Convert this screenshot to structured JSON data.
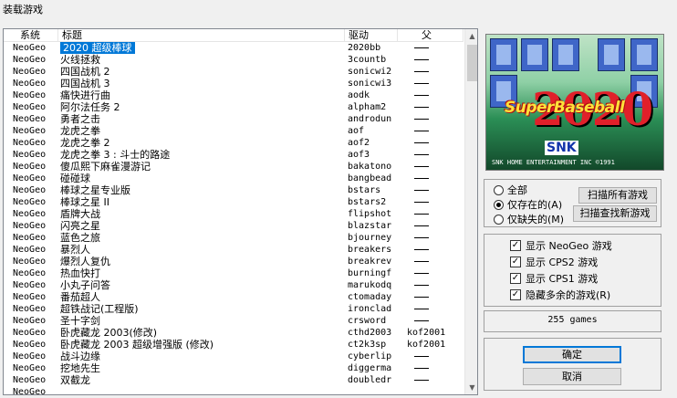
{
  "window": {
    "title": "装载游戏"
  },
  "list": {
    "headers": {
      "system": "系统",
      "title": "标题",
      "driver": "驱动",
      "parent": "父"
    },
    "rows": [
      {
        "system": "NeoGeo",
        "title": "2020 超级棒球",
        "driver": "2020bb",
        "parent": "",
        "selected": true
      },
      {
        "system": "NeoGeo",
        "title": "火线拯救",
        "driver": "3countb",
        "parent": ""
      },
      {
        "system": "NeoGeo",
        "title": "四国战机 2",
        "driver": "sonicwi2",
        "parent": ""
      },
      {
        "system": "NeoGeo",
        "title": "四国战机 3",
        "driver": "sonicwi3",
        "parent": ""
      },
      {
        "system": "NeoGeo",
        "title": "痛快进行曲",
        "driver": "aodk",
        "parent": ""
      },
      {
        "system": "NeoGeo",
        "title": "阿尔法任务 2",
        "driver": "alpham2",
        "parent": ""
      },
      {
        "system": "NeoGeo",
        "title": "勇者之击",
        "driver": "androdun",
        "parent": ""
      },
      {
        "system": "NeoGeo",
        "title": "龙虎之拳",
        "driver": "aof",
        "parent": ""
      },
      {
        "system": "NeoGeo",
        "title": "龙虎之拳 2",
        "driver": "aof2",
        "parent": ""
      },
      {
        "system": "NeoGeo",
        "title": "龙虎之拳 3 : 斗士的路途",
        "driver": "aof3",
        "parent": ""
      },
      {
        "system": "NeoGeo",
        "title": "傻瓜熙下麻雀漫游记",
        "driver": "bakatono",
        "parent": ""
      },
      {
        "system": "NeoGeo",
        "title": "碰碰球",
        "driver": "bangbead",
        "parent": ""
      },
      {
        "system": "NeoGeo",
        "title": "棒球之星专业版",
        "driver": "bstars",
        "parent": ""
      },
      {
        "system": "NeoGeo",
        "title": "棒球之星 II",
        "driver": "bstars2",
        "parent": ""
      },
      {
        "system": "NeoGeo",
        "title": "盾牌大战",
        "driver": "flipshot",
        "parent": ""
      },
      {
        "system": "NeoGeo",
        "title": "闪亮之星",
        "driver": "blazstar",
        "parent": ""
      },
      {
        "system": "NeoGeo",
        "title": "蓝色之旅",
        "driver": "bjourney",
        "parent": ""
      },
      {
        "system": "NeoGeo",
        "title": "暴烈人",
        "driver": "breakers",
        "parent": ""
      },
      {
        "system": "NeoGeo",
        "title": "爆烈人复仇",
        "driver": "breakrev",
        "parent": ""
      },
      {
        "system": "NeoGeo",
        "title": "热血快打",
        "driver": "burningf",
        "parent": ""
      },
      {
        "system": "NeoGeo",
        "title": "小丸子问答",
        "driver": "marukodq",
        "parent": ""
      },
      {
        "system": "NeoGeo",
        "title": "番茄超人",
        "driver": "ctomaday",
        "parent": ""
      },
      {
        "system": "NeoGeo",
        "title": "超铁战记(工程版)",
        "driver": "ironclad",
        "parent": ""
      },
      {
        "system": "NeoGeo",
        "title": "圣十字剑",
        "driver": "crsword",
        "parent": ""
      },
      {
        "system": "NeoGeo",
        "title": "卧虎藏龙 2003(修改)",
        "driver": "cthd2003",
        "parent": "kof2001"
      },
      {
        "system": "NeoGeo",
        "title": "卧虎藏龙 2003 超级增强版 (修改)",
        "driver": "ct2k3sp",
        "parent": "kof2001"
      },
      {
        "system": "NeoGeo",
        "title": "战斗边缘",
        "driver": "cyberlip",
        "parent": ""
      },
      {
        "system": "NeoGeo",
        "title": "挖地先生",
        "driver": "diggerma",
        "parent": ""
      },
      {
        "system": "NeoGeo",
        "title": "双截龙",
        "driver": "doubledr",
        "parent": ""
      },
      {
        "system": "NeoGeo",
        "title": "",
        "driver": "",
        "parent": ""
      }
    ]
  },
  "preview": {
    "number": "2020",
    "logo": "SuperBaseball",
    "brand": "SNK",
    "copyright": "SNK HOME ENTERTAINMENT INC ©1991"
  },
  "filter": {
    "all_label": "全部",
    "available_label": "仅存在的(A)",
    "missing_label": "仅缺失的(M)",
    "selected": "available",
    "scan_all_button": "扫描所有游戏",
    "scan_new_button": "扫描查找新游戏"
  },
  "options": {
    "show_neogeo": "显示 NeoGeo 游戏",
    "show_cps2": "显示 CPS2 游戏",
    "show_cps1": "显示 CPS1 游戏",
    "hide_extra": "隐藏多余的游戏(R)"
  },
  "count": {
    "text": "255 games"
  },
  "buttons": {
    "ok": "确定",
    "cancel": "取消"
  },
  "colors": {
    "selection": "#0078d7",
    "background": "#f0f0f0"
  }
}
